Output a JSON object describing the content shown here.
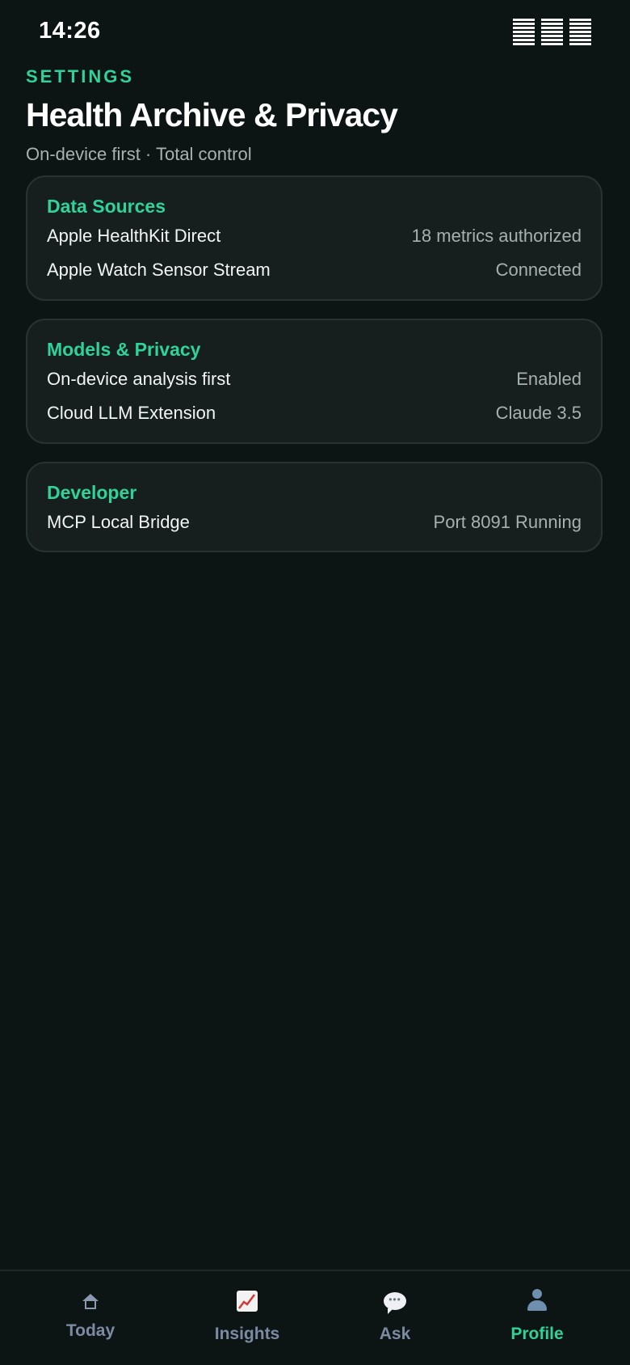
{
  "status_bar": {
    "time": "14:26",
    "icons": [
      "signal-icon",
      "wifi-icon",
      "battery-icon"
    ]
  },
  "header": {
    "eyebrow": "SETTINGS",
    "title": "Health Archive & Privacy",
    "subtitle": "On-device first · Total control"
  },
  "sections": [
    {
      "title": "Data Sources",
      "rows": [
        {
          "label": "Apple HealthKit Direct",
          "value": "18 metrics authorized"
        },
        {
          "label": "Apple Watch Sensor Stream",
          "value": "Connected"
        }
      ]
    },
    {
      "title": "Models & Privacy",
      "rows": [
        {
          "label": "On-device analysis first",
          "value": "Enabled"
        },
        {
          "label": "Cloud LLM Extension",
          "value": "Claude 3.5"
        }
      ]
    },
    {
      "title": "Developer",
      "rows": [
        {
          "label": "MCP Local Bridge",
          "value": "Port 8091 Running"
        }
      ]
    }
  ],
  "tab_bar": {
    "active": "Profile",
    "tabs": [
      {
        "label": "Today",
        "icon": "home-icon"
      },
      {
        "label": "Insights",
        "icon": "chart-icon"
      },
      {
        "label": "Ask",
        "icon": "chat-bubble-icon"
      },
      {
        "label": "Profile",
        "icon": "person-icon"
      }
    ]
  },
  "colors": {
    "background": "#0d1514",
    "card": "#161f1e",
    "accent": "#2fd39a",
    "secondary_text": "#a6b1af",
    "inactive_tab": "#7c8aa3"
  }
}
